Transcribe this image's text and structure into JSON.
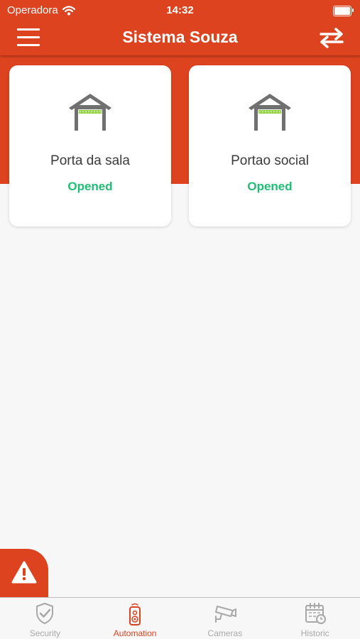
{
  "status_bar": {
    "carrier": "Operadora",
    "time": "14:32"
  },
  "nav": {
    "title": "Sistema Souza",
    "menu_icon": "hamburger-icon",
    "swap_icon": "swap-arrows-icon"
  },
  "devices": [
    {
      "name": "Porta da sala",
      "status": "Opened",
      "icon": "garage-icon"
    },
    {
      "name": "Portao social",
      "status": "Opened",
      "icon": "garage-icon"
    }
  ],
  "alert_button": {
    "icon": "warning-icon"
  },
  "tabs": [
    {
      "label": "Security",
      "icon": "shield-check-icon",
      "active": false
    },
    {
      "label": "Automation",
      "icon": "remote-control-icon",
      "active": true
    },
    {
      "label": "Cameras",
      "icon": "security-camera-icon",
      "active": false
    },
    {
      "label": "Historic",
      "icon": "calendar-icon",
      "active": false
    }
  ],
  "colors": {
    "accent": "#de4320",
    "status_open": "#1fbf73",
    "tab_inactive": "#a8a8a8"
  }
}
